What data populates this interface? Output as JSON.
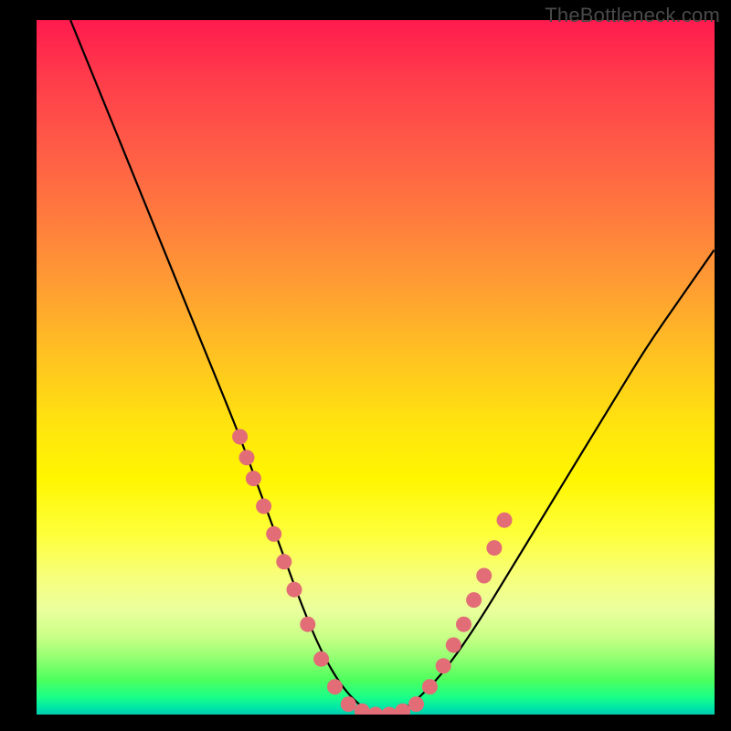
{
  "watermark": "TheBottleneck.com",
  "colors": {
    "background": "#000000",
    "curve": "#000000",
    "dots": "#e26d77"
  },
  "chart_data": {
    "type": "line",
    "title": "",
    "xlabel": "",
    "ylabel": "",
    "xlim": [
      0,
      100
    ],
    "ylim": [
      0,
      100
    ],
    "grid": false,
    "series": [
      {
        "name": "bottleneck-curve",
        "x": [
          5,
          10,
          15,
          20,
          25,
          30,
          33,
          36,
          39,
          42,
          45,
          48,
          50,
          53,
          56,
          60,
          65,
          70,
          75,
          80,
          85,
          90,
          95,
          100
        ],
        "y": [
          100,
          88,
          76,
          64,
          52,
          40,
          32,
          24,
          16,
          9,
          4,
          1,
          0,
          0,
          2,
          6,
          13,
          21,
          29,
          37,
          45,
          53,
          60,
          67
        ]
      }
    ],
    "markers": [
      {
        "name": "left-cluster-dots",
        "x": [
          30,
          31,
          32,
          33.5,
          35,
          36.5,
          38,
          40,
          42,
          44
        ],
        "y": [
          40,
          37,
          34,
          30,
          26,
          22,
          18,
          13,
          8,
          4
        ]
      },
      {
        "name": "valley-dots",
        "x": [
          46,
          48,
          50,
          52,
          54,
          56
        ],
        "y": [
          1.5,
          0.5,
          0,
          0,
          0.5,
          1.5
        ]
      },
      {
        "name": "right-cluster-dots",
        "x": [
          58,
          60,
          61.5,
          63,
          64.5,
          66,
          67.5,
          69
        ],
        "y": [
          4,
          7,
          10,
          13,
          16.5,
          20,
          24,
          28
        ]
      }
    ]
  }
}
